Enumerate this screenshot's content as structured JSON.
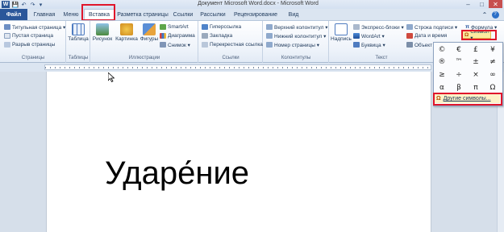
{
  "window": {
    "title": "Документ Microsoft Word.docx - Microsoft Word",
    "app_letter": "W",
    "qat": {
      "save_glyph": "💾",
      "undo_glyph": "↶",
      "redo_glyph": "↷",
      "customize_glyph": "▾"
    },
    "controls": {
      "minimize": "–",
      "maximize": "□",
      "close": "✕"
    }
  },
  "tabs": {
    "file": "Файл",
    "items": [
      "Главная",
      "Меню",
      "Вставка",
      "Разметка страницы",
      "Ссылки",
      "Рассылки",
      "Рецензирование",
      "Вид"
    ],
    "active": "Вставка"
  },
  "ribbon": {
    "pages": {
      "items": [
        "Титульная страница ▾",
        "Пустая страница",
        "Разрыв страницы"
      ],
      "label": "Страницы"
    },
    "tables": {
      "button": "Таблица",
      "label": "Таблицы"
    },
    "illustrations": {
      "big": [
        "Рисунок",
        "Картинка",
        "Фигуры"
      ],
      "small": [
        "SmartArt",
        "Диаграмма",
        "Снимок ▾"
      ],
      "label": "Иллюстрации"
    },
    "links": {
      "items": [
        "Гиперссылка",
        "Закладка",
        "Перекрестная ссылка"
      ],
      "label": "Ссылки"
    },
    "headerfooter": {
      "items": [
        "Верхний колонтитул ▾",
        "Нижний колонтитул ▾",
        "Номер страницы ▾"
      ],
      "label": "Колонтитулы"
    },
    "text": {
      "big": "Надпись",
      "items": [
        "Экспресс-блоки ▾",
        "WordArt ▾",
        "Буквица ▾"
      ],
      "items2": [
        "Строка подписи ▾",
        "Дата и время",
        "Объект ▾"
      ],
      "label": "Текст"
    },
    "symbols": {
      "formula": "Формула ▾",
      "symbol": "Символ ▾"
    }
  },
  "symbol_menu": {
    "rows": [
      [
        "©",
        "€",
        "£",
        "¥"
      ],
      [
        "®",
        "™",
        "±",
        "≠"
      ],
      [
        "≥",
        "÷",
        "×",
        "∞"
      ],
      [
        "α",
        "β",
        "π",
        "Ω"
      ]
    ],
    "extra_column": [
      "©",
      "≤",
      "µ",
      "∑"
    ],
    "more": "Другие символы..."
  },
  "document": {
    "text": "Ударе́ние"
  },
  "colors": {
    "file_tab": "#2b579a",
    "highlight": "#e0162b",
    "ribbon_bg": "#eef3fa"
  }
}
